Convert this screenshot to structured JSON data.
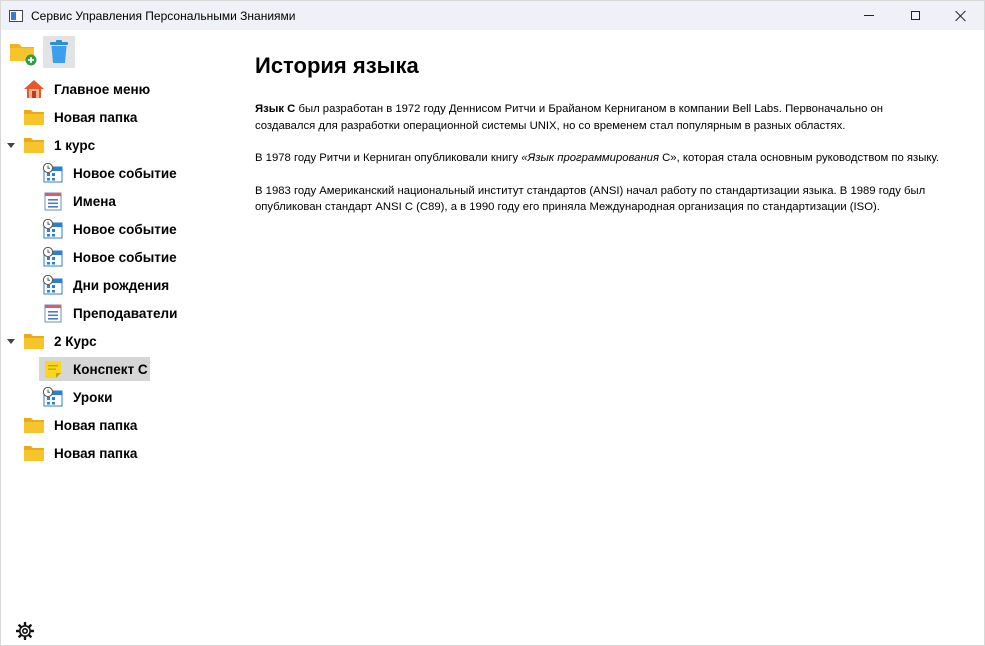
{
  "window": {
    "title": "Сервис Управления Персональными Знаниями"
  },
  "toolbar": {
    "add_folder_icon": "folder-add-icon",
    "delete_icon": "trash-icon"
  },
  "tree": {
    "items": [
      {
        "label": "Главное меню",
        "icon": "home-icon"
      },
      {
        "label": "Новая папка",
        "icon": "folder-icon"
      },
      {
        "label": "1 курс",
        "icon": "folder-icon",
        "expanded": true
      },
      {
        "label": "Новое событие",
        "icon": "calendar-clock-icon"
      },
      {
        "label": "Имена",
        "icon": "list-icon"
      },
      {
        "label": "Новое событие",
        "icon": "calendar-clock-icon"
      },
      {
        "label": "Новое событие",
        "icon": "calendar-clock-icon"
      },
      {
        "label": "Дни рождения",
        "icon": "calendar-clock-icon"
      },
      {
        "label": "Преподаватели",
        "icon": "list-icon"
      },
      {
        "label": "2 Курс",
        "icon": "folder-icon",
        "expanded": true
      },
      {
        "label": "Конспект C",
        "icon": "note-icon",
        "selected": true
      },
      {
        "label": "Уроки",
        "icon": "calendar-clock-icon"
      },
      {
        "label": "Новая папка",
        "icon": "folder-icon"
      },
      {
        "label": "Новая папка",
        "icon": "folder-icon"
      }
    ]
  },
  "document": {
    "title": "История языка",
    "p1_bold": "Язык C",
    "p1_rest": " был разработан в 1972 году Деннисом Ритчи и Брайаном Керниганом в компании Bell Labs. Первоначально он создавался для разработки операционной системы UNIX, но со временем стал популярным в разных областях.",
    "p2_start": "В 1978 году Ритчи и Керниган опубликовали книгу ",
    "p2_italic": "«Язык программирования",
    "p2_mid": " C»",
    "p2_end": ", которая стала основным руководством по языку.",
    "p3": "В 1983 году Американский национальный институт стандартов (ANSI) начал работу по стандартизации языка. В 1989 году был опубликован стандарт ANSI C (C89), а в 1990 году его приняла Международная организация по стандартизации (ISO)."
  },
  "colors": {
    "titlebar_bg": "#eef1f7",
    "folder": "#f7c42e",
    "selection": "#d6d6d6"
  }
}
